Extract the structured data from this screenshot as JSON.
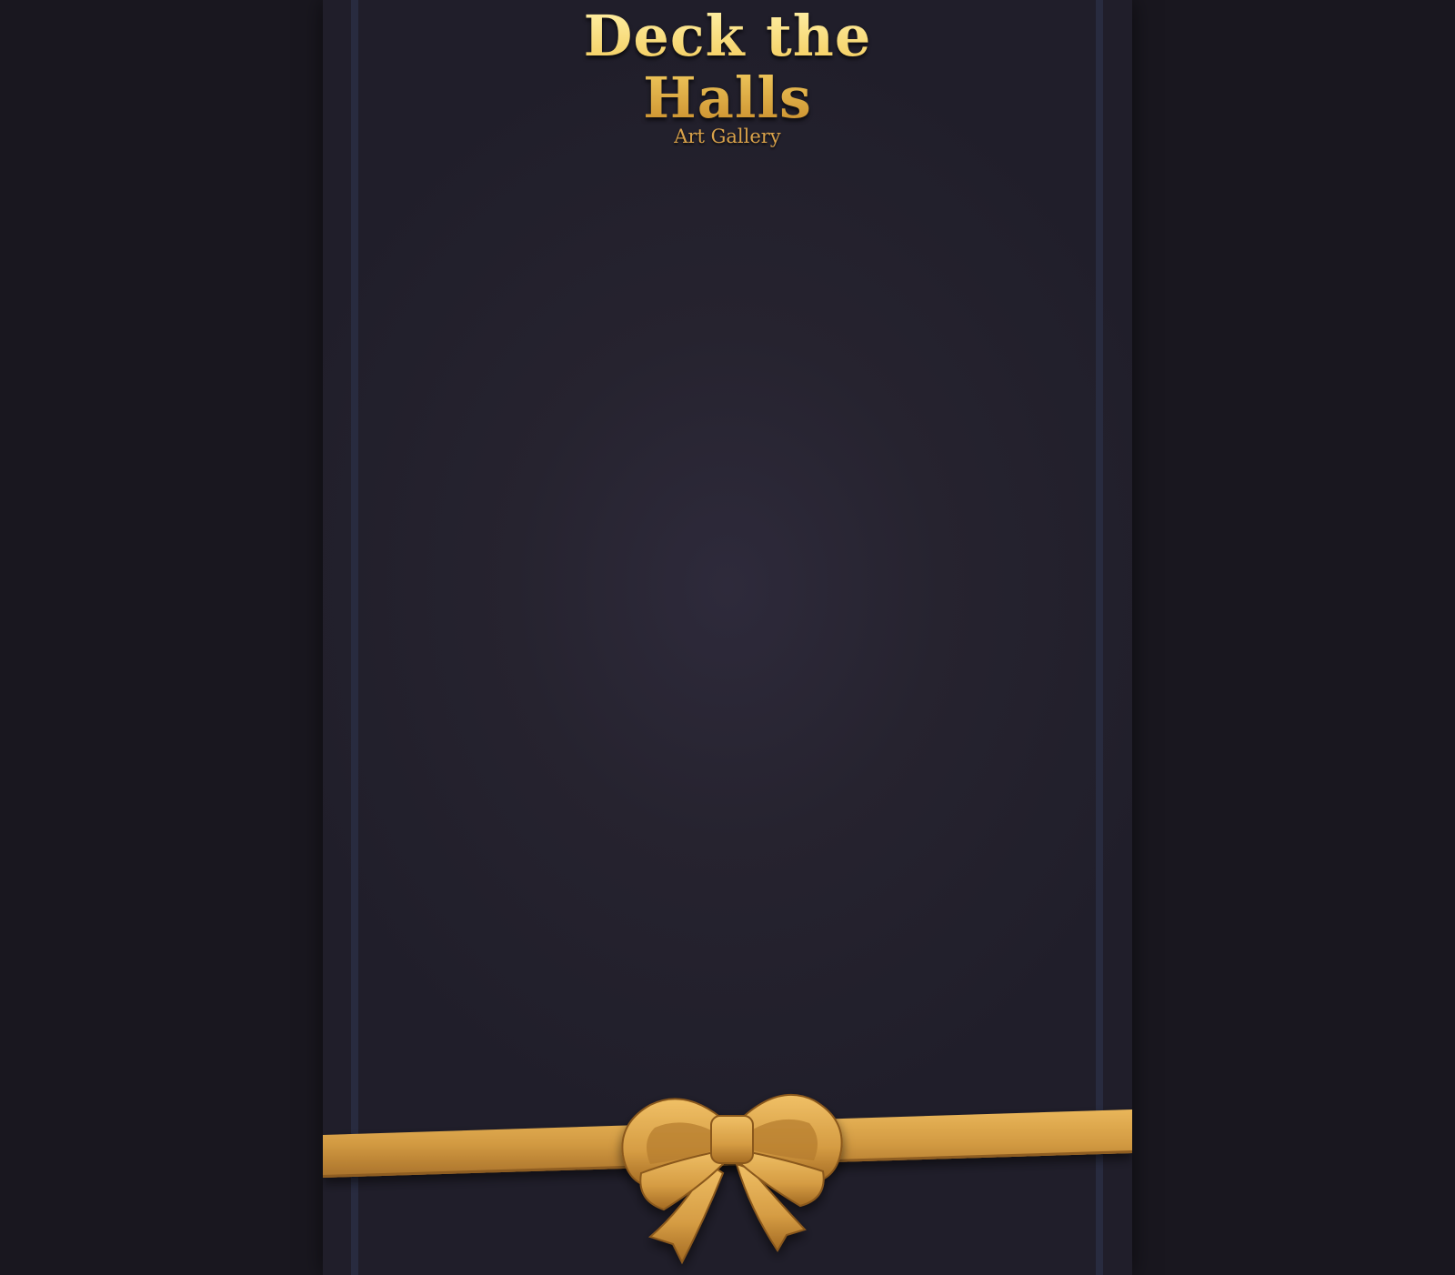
{
  "header": {
    "title": "Deck the Halls",
    "subtitle": "Art Gallery"
  },
  "colors": {
    "background": "#19171f",
    "panel": "#26232f",
    "rail": "#282b3f",
    "gold": "#e0a84a",
    "gold_dark": "#b07a2a"
  },
  "icons": {
    "bow": "gift-bow-icon",
    "ribbon": "ribbon-icon"
  }
}
